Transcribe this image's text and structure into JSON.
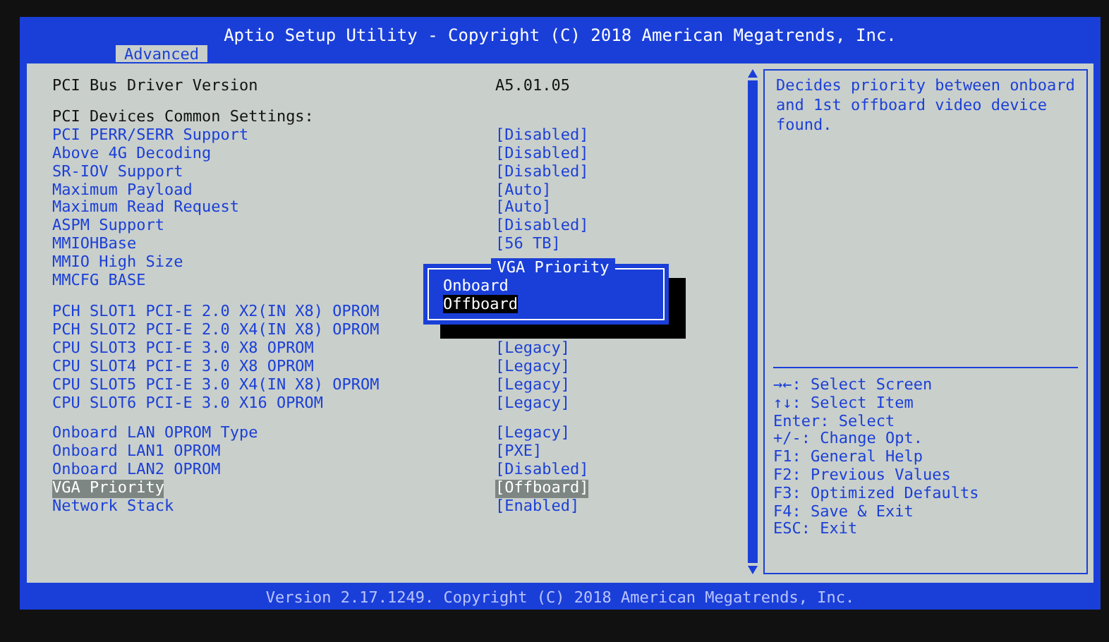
{
  "header": {
    "title": "Aptio Setup Utility - Copyright (C) 2018 American Megatrends, Inc.",
    "tabs": [
      {
        "label": "Advanced",
        "selected": true
      }
    ]
  },
  "sections": [
    {
      "rows": [
        {
          "kind": "info",
          "label": "PCI Bus Driver Version",
          "value": "A5.01.05",
          "selected": false
        }
      ]
    },
    {
      "rows": [
        {
          "kind": "heading",
          "label": "PCI Devices Common Settings:",
          "selected": false
        },
        {
          "kind": "option",
          "label": "PCI PERR/SERR Support",
          "value": "[Disabled]",
          "selected": false
        },
        {
          "kind": "option",
          "label": "Above 4G Decoding",
          "value": "[Disabled]",
          "selected": false
        },
        {
          "kind": "option",
          "label": "SR-IOV Support",
          "value": "[Disabled]",
          "selected": false
        },
        {
          "kind": "option",
          "label": "Maximum Payload",
          "value": "[Auto]",
          "selected": false
        },
        {
          "kind": "option",
          "label": "Maximum Read Request",
          "value": "[Auto]",
          "selected": false
        },
        {
          "kind": "option",
          "label": "ASPM Support",
          "value": "[Disabled]",
          "selected": false
        },
        {
          "kind": "option",
          "label": "MMIOHBase",
          "value": "[56 TB]",
          "selected": false
        },
        {
          "kind": "option",
          "label": "MMIO High Size",
          "selected": false
        },
        {
          "kind": "option",
          "label": "MMCFG BASE",
          "selected": false
        }
      ]
    },
    {
      "rows": [
        {
          "kind": "option",
          "label": "PCH SLOT1 PCI-E 2.0 X2(IN X8) OPROM",
          "selected": false
        },
        {
          "kind": "option",
          "label": "PCH SLOT2 PCI-E 2.0 X4(IN X8) OPROM",
          "selected": false
        },
        {
          "kind": "option",
          "label": "CPU SLOT3 PCI-E 3.0 X8 OPROM",
          "value": "[Legacy]",
          "selected": false
        },
        {
          "kind": "option",
          "label": "CPU SLOT4 PCI-E 3.0 X8 OPROM",
          "value": "[Legacy]",
          "selected": false
        },
        {
          "kind": "option",
          "label": "CPU SLOT5 PCI-E 3.0 X4(IN X8) OPROM",
          "value": "[Legacy]",
          "selected": false
        },
        {
          "kind": "option",
          "label": "CPU SLOT6 PCI-E 3.0 X16 OPROM",
          "value": "[Legacy]",
          "selected": false
        }
      ]
    },
    {
      "rows": [
        {
          "kind": "option",
          "label": "Onboard LAN OPROM Type",
          "value": "[Legacy]",
          "selected": false
        },
        {
          "kind": "option",
          "label": "Onboard LAN1 OPROM",
          "value": "[PXE]",
          "selected": false
        },
        {
          "kind": "option",
          "label": "Onboard LAN2 OPROM",
          "value": "[Disabled]",
          "selected": false
        },
        {
          "kind": "option",
          "label": "VGA Priority",
          "value": "[Offboard]",
          "selected": true
        },
        {
          "kind": "option",
          "label": "Network Stack",
          "value": "[Enabled]",
          "selected": false
        }
      ]
    }
  ],
  "popup": {
    "title": "VGA Priority",
    "options": [
      {
        "label": "Onboard",
        "selected": false
      },
      {
        "label": "Offboard",
        "selected": true
      }
    ]
  },
  "help": {
    "description": "Decides priority between onboard and 1st offboard video device found.",
    "keys": [
      "→←: Select Screen",
      "↑↓: Select Item",
      "Enter: Select",
      "+/-: Change Opt.",
      "F1: General Help",
      "F2: Previous Values",
      "F3: Optimized Defaults",
      "F4: Save & Exit",
      "ESC: Exit"
    ]
  },
  "footer": "Version 2.17.1249. Copyright (C) 2018 American Megatrends, Inc."
}
